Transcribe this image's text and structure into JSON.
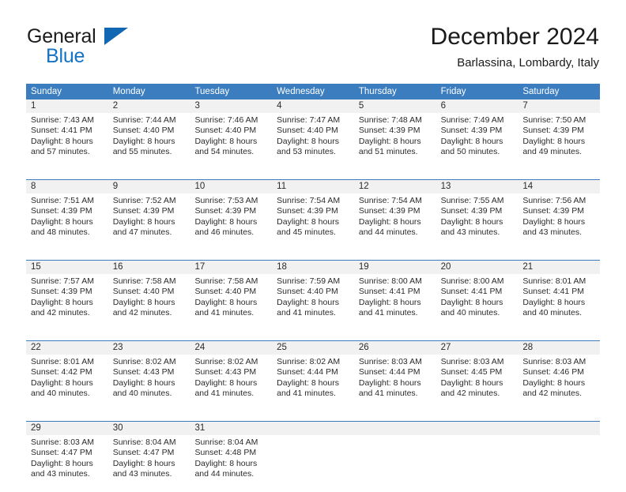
{
  "logo": {
    "word_one": "General",
    "word_two": "Blue",
    "accent_color": "#1473c4",
    "triangle_color": "#1167b1",
    "triangle_icon": "triangle-logo-icon"
  },
  "header": {
    "title": "December 2024",
    "location": "Barlassina, Lombardy, Italy"
  },
  "calendar": {
    "header_color": "#3b7dbf",
    "daynum_band_color": "#f1f1f1",
    "weekdays": [
      "Sunday",
      "Monday",
      "Tuesday",
      "Wednesday",
      "Thursday",
      "Friday",
      "Saturday"
    ],
    "weeks": [
      [
        {
          "day": "1",
          "lines": [
            "Sunrise: 7:43 AM",
            "Sunset: 4:41 PM",
            "Daylight: 8 hours",
            "and 57 minutes."
          ]
        },
        {
          "day": "2",
          "lines": [
            "Sunrise: 7:44 AM",
            "Sunset: 4:40 PM",
            "Daylight: 8 hours",
            "and 55 minutes."
          ]
        },
        {
          "day": "3",
          "lines": [
            "Sunrise: 7:46 AM",
            "Sunset: 4:40 PM",
            "Daylight: 8 hours",
            "and 54 minutes."
          ]
        },
        {
          "day": "4",
          "lines": [
            "Sunrise: 7:47 AM",
            "Sunset: 4:40 PM",
            "Daylight: 8 hours",
            "and 53 minutes."
          ]
        },
        {
          "day": "5",
          "lines": [
            "Sunrise: 7:48 AM",
            "Sunset: 4:39 PM",
            "Daylight: 8 hours",
            "and 51 minutes."
          ]
        },
        {
          "day": "6",
          "lines": [
            "Sunrise: 7:49 AM",
            "Sunset: 4:39 PM",
            "Daylight: 8 hours",
            "and 50 minutes."
          ]
        },
        {
          "day": "7",
          "lines": [
            "Sunrise: 7:50 AM",
            "Sunset: 4:39 PM",
            "Daylight: 8 hours",
            "and 49 minutes."
          ]
        }
      ],
      [
        {
          "day": "8",
          "lines": [
            "Sunrise: 7:51 AM",
            "Sunset: 4:39 PM",
            "Daylight: 8 hours",
            "and 48 minutes."
          ]
        },
        {
          "day": "9",
          "lines": [
            "Sunrise: 7:52 AM",
            "Sunset: 4:39 PM",
            "Daylight: 8 hours",
            "and 47 minutes."
          ]
        },
        {
          "day": "10",
          "lines": [
            "Sunrise: 7:53 AM",
            "Sunset: 4:39 PM",
            "Daylight: 8 hours",
            "and 46 minutes."
          ]
        },
        {
          "day": "11",
          "lines": [
            "Sunrise: 7:54 AM",
            "Sunset: 4:39 PM",
            "Daylight: 8 hours",
            "and 45 minutes."
          ]
        },
        {
          "day": "12",
          "lines": [
            "Sunrise: 7:54 AM",
            "Sunset: 4:39 PM",
            "Daylight: 8 hours",
            "and 44 minutes."
          ]
        },
        {
          "day": "13",
          "lines": [
            "Sunrise: 7:55 AM",
            "Sunset: 4:39 PM",
            "Daylight: 8 hours",
            "and 43 minutes."
          ]
        },
        {
          "day": "14",
          "lines": [
            "Sunrise: 7:56 AM",
            "Sunset: 4:39 PM",
            "Daylight: 8 hours",
            "and 43 minutes."
          ]
        }
      ],
      [
        {
          "day": "15",
          "lines": [
            "Sunrise: 7:57 AM",
            "Sunset: 4:39 PM",
            "Daylight: 8 hours",
            "and 42 minutes."
          ]
        },
        {
          "day": "16",
          "lines": [
            "Sunrise: 7:58 AM",
            "Sunset: 4:40 PM",
            "Daylight: 8 hours",
            "and 42 minutes."
          ]
        },
        {
          "day": "17",
          "lines": [
            "Sunrise: 7:58 AM",
            "Sunset: 4:40 PM",
            "Daylight: 8 hours",
            "and 41 minutes."
          ]
        },
        {
          "day": "18",
          "lines": [
            "Sunrise: 7:59 AM",
            "Sunset: 4:40 PM",
            "Daylight: 8 hours",
            "and 41 minutes."
          ]
        },
        {
          "day": "19",
          "lines": [
            "Sunrise: 8:00 AM",
            "Sunset: 4:41 PM",
            "Daylight: 8 hours",
            "and 41 minutes."
          ]
        },
        {
          "day": "20",
          "lines": [
            "Sunrise: 8:00 AM",
            "Sunset: 4:41 PM",
            "Daylight: 8 hours",
            "and 40 minutes."
          ]
        },
        {
          "day": "21",
          "lines": [
            "Sunrise: 8:01 AM",
            "Sunset: 4:41 PM",
            "Daylight: 8 hours",
            "and 40 minutes."
          ]
        }
      ],
      [
        {
          "day": "22",
          "lines": [
            "Sunrise: 8:01 AM",
            "Sunset: 4:42 PM",
            "Daylight: 8 hours",
            "and 40 minutes."
          ]
        },
        {
          "day": "23",
          "lines": [
            "Sunrise: 8:02 AM",
            "Sunset: 4:43 PM",
            "Daylight: 8 hours",
            "and 40 minutes."
          ]
        },
        {
          "day": "24",
          "lines": [
            "Sunrise: 8:02 AM",
            "Sunset: 4:43 PM",
            "Daylight: 8 hours",
            "and 41 minutes."
          ]
        },
        {
          "day": "25",
          "lines": [
            "Sunrise: 8:02 AM",
            "Sunset: 4:44 PM",
            "Daylight: 8 hours",
            "and 41 minutes."
          ]
        },
        {
          "day": "26",
          "lines": [
            "Sunrise: 8:03 AM",
            "Sunset: 4:44 PM",
            "Daylight: 8 hours",
            "and 41 minutes."
          ]
        },
        {
          "day": "27",
          "lines": [
            "Sunrise: 8:03 AM",
            "Sunset: 4:45 PM",
            "Daylight: 8 hours",
            "and 42 minutes."
          ]
        },
        {
          "day": "28",
          "lines": [
            "Sunrise: 8:03 AM",
            "Sunset: 4:46 PM",
            "Daylight: 8 hours",
            "and 42 minutes."
          ]
        }
      ],
      [
        {
          "day": "29",
          "lines": [
            "Sunrise: 8:03 AM",
            "Sunset: 4:47 PM",
            "Daylight: 8 hours",
            "and 43 minutes."
          ]
        },
        {
          "day": "30",
          "lines": [
            "Sunrise: 8:04 AM",
            "Sunset: 4:47 PM",
            "Daylight: 8 hours",
            "and 43 minutes."
          ]
        },
        {
          "day": "31",
          "lines": [
            "Sunrise: 8:04 AM",
            "Sunset: 4:48 PM",
            "Daylight: 8 hours",
            "and 44 minutes."
          ]
        },
        {
          "day": "",
          "lines": []
        },
        {
          "day": "",
          "lines": []
        },
        {
          "day": "",
          "lines": []
        },
        {
          "day": "",
          "lines": []
        }
      ]
    ]
  }
}
